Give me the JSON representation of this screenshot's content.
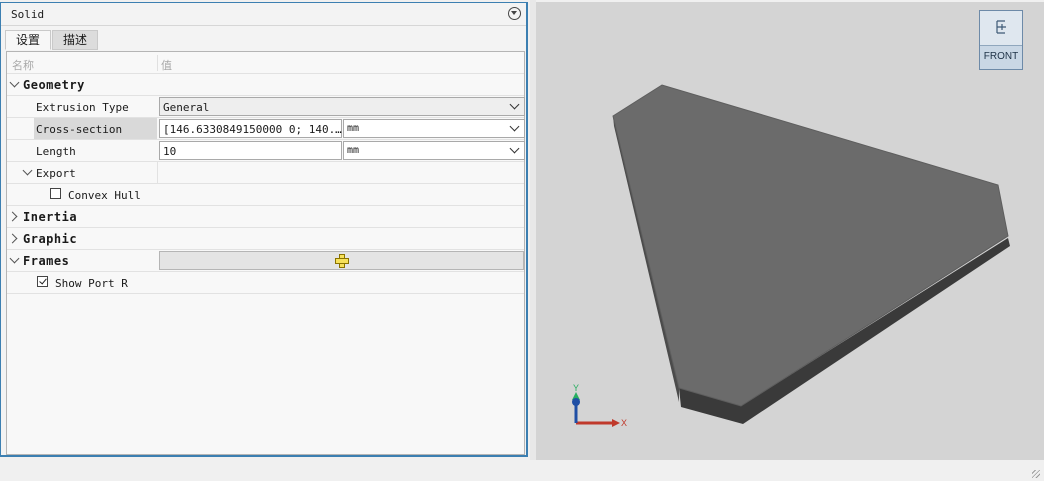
{
  "panel": {
    "title": "Solid",
    "tabs": [
      "设置",
      "描述"
    ],
    "header": {
      "name": "名称",
      "value": "值"
    }
  },
  "properties": {
    "geometry": {
      "label": "Geometry",
      "extrusion_type": {
        "label": "Extrusion Type",
        "value": "General"
      },
      "cross_section": {
        "label": "Cross-section",
        "value": "[146.6330849150000 0; 140.…",
        "unit": "mm"
      },
      "length": {
        "label": "Length",
        "value": "10",
        "unit": "mm"
      },
      "export": {
        "label": "Export",
        "convex_hull": {
          "label": "Convex Hull",
          "checked": false
        }
      }
    },
    "inertia": {
      "label": "Inertia"
    },
    "graphic": {
      "label": "Graphic"
    },
    "frames": {
      "label": "Frames",
      "show_port_r": {
        "label": "Show Port R",
        "checked": true
      }
    }
  },
  "viewport": {
    "view_cube": {
      "label": "FRONT"
    },
    "axes": {
      "x": "X",
      "y": "Y"
    },
    "colors": {
      "background": "#d4d4d4",
      "solid_face": "#6b6b6b",
      "solid_edge": "#3a3a3a",
      "x_axis": "#c0392b",
      "y_axis": "#27ae60",
      "z_axis": "#1f4fa5"
    }
  }
}
